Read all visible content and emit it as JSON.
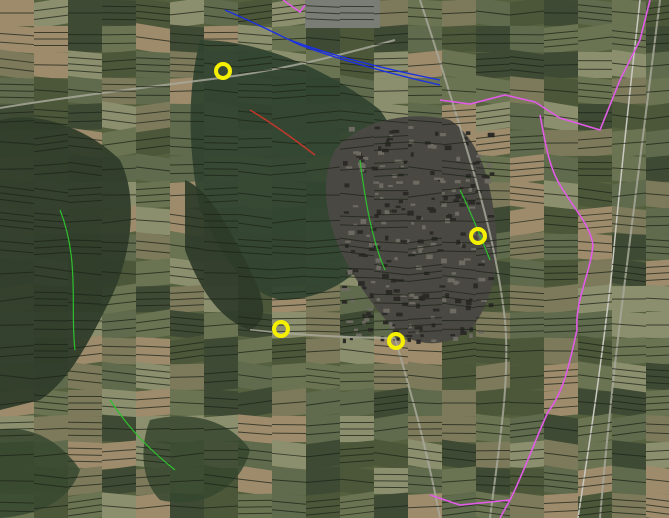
{
  "map": {
    "imagery": "aerial-orthophoto",
    "colors": {
      "field_dark": "#3f4a34",
      "field_mid": "#5f6b4c",
      "field_light": "#8b8f6e",
      "field_tan": "#9d8b6c",
      "forest": "#2f3d2a",
      "village": "#4a4a44",
      "parcel_line": "#1d2418",
      "boundary_magenta": "#e05ce6",
      "powerline_blue": "#1b2fe6",
      "marker_yellow": "#f5f000",
      "stream_green": "#2fbf2f",
      "red_path": "#c0392b"
    },
    "markers": [
      {
        "name": "marker-1",
        "icon": "yellow-ring"
      },
      {
        "name": "marker-2",
        "icon": "yellow-ring"
      },
      {
        "name": "marker-3",
        "icon": "yellow-ring"
      },
      {
        "name": "marker-4",
        "icon": "yellow-ring"
      }
    ]
  }
}
